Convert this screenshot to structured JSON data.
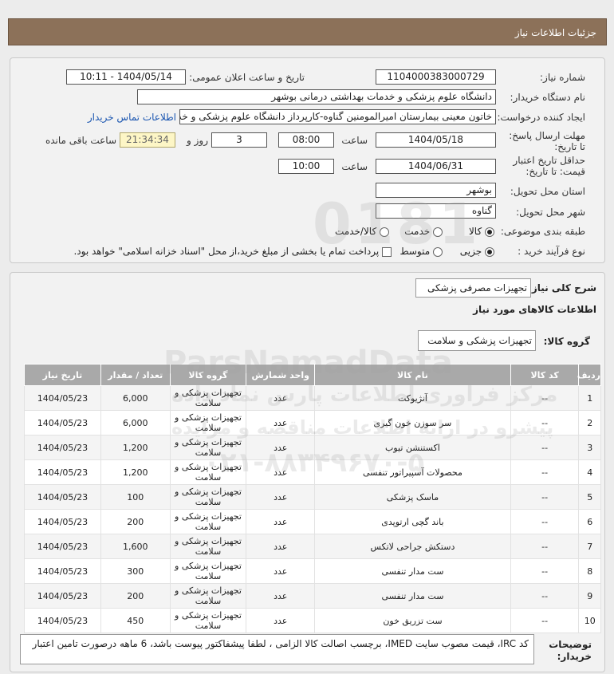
{
  "header": {
    "title": "جزئیات اطلاعات نیاز"
  },
  "info": {
    "need_number_label": "شماره نیاز:",
    "need_number": "1104000383000729",
    "announce_label": "تاریخ و ساعت اعلان عمومی:",
    "announce_value": "1404/05/14 - 10:11",
    "buyer_org_label": "نام دستگاه خریدار:",
    "buyer_org": "دانشگاه علوم پزشکی و خدمات بهداشتی درمانی بوشهر",
    "creator_label": "ایجاد کننده درخواست:",
    "creator": "خاتون معینی بیمارستان امیرالمومنین گناوه-کارپرداز دانشگاه علوم پزشکی و خدم",
    "contact_link": "اطلاعات تماس خریدار",
    "deadline_label": "مهلت ارسال پاسخ: تا تاریخ:",
    "deadline_date": "1404/05/18",
    "time_label": "ساعت",
    "deadline_time": "08:00",
    "days_value": "3",
    "days_label": "روز و",
    "remaining_time": "21:34:34",
    "remaining_label": "ساعت باقی مانده",
    "validity_label": "حداقل تاریخ اعتبار قیمت: تا تاریخ:",
    "validity_date": "1404/06/31",
    "validity_time": "10:00",
    "province_label": "استان محل تحویل:",
    "province": "بوشهر",
    "city_label": "شهر محل تحویل:",
    "city": "گناوه",
    "category_label": "طبقه بندی موضوعی:",
    "category_options": [
      "کالا",
      "خدمت",
      "کالا/خدمت"
    ],
    "category_selected": "کالا",
    "process_label": "نوع فرآیند خرید :",
    "process_options": [
      "جزیی",
      "متوسط"
    ],
    "process_selected": "جزیی",
    "payment_note": "پرداخت تمام یا بخشی از مبلغ خرید،از محل \"اسناد خزانه اسلامی\" خواهد بود."
  },
  "details": {
    "summary_label": "شرح کلی نیاز:",
    "summary": "تجهیزات مصرفی پزشکی",
    "goods_info_title": "اطلاعات کالاهای مورد نیاز",
    "group_label": "گروه کالا:",
    "group": "تجهیزات پزشکی و سلامت",
    "columns": [
      "ردیف",
      "کد کالا",
      "نام کالا",
      "واحد شمارش",
      "گروه کالا",
      "تعداد / مقدار",
      "تاریخ نیاز"
    ],
    "rows": [
      {
        "row": "1",
        "code": "--",
        "name": "آنژیوکت",
        "unit": "عدد",
        "group": "تجهیزات پزشکی و سلامت",
        "qty": "6,000",
        "date": "1404/05/23"
      },
      {
        "row": "2",
        "code": "--",
        "name": "سر سوزن خون گیری",
        "unit": "عدد",
        "group": "تجهیزات پزشکی و سلامت",
        "qty": "6,000",
        "date": "1404/05/23"
      },
      {
        "row": "3",
        "code": "--",
        "name": "اکستنشن تیوب",
        "unit": "عدد",
        "group": "تجهیزات پزشکی و سلامت",
        "qty": "1,200",
        "date": "1404/05/23"
      },
      {
        "row": "4",
        "code": "--",
        "name": "محصولات آسپیراتور تنفسی",
        "unit": "عدد",
        "group": "تجهیزات پزشکی و سلامت",
        "qty": "1,200",
        "date": "1404/05/23"
      },
      {
        "row": "5",
        "code": "--",
        "name": "ماسک پزشکی",
        "unit": "عدد",
        "group": "تجهیزات پزشکی و سلامت",
        "qty": "100",
        "date": "1404/05/23"
      },
      {
        "row": "6",
        "code": "--",
        "name": "باند گچی ارتوپدی",
        "unit": "عدد",
        "group": "تجهیزات پزشکی و سلامت",
        "qty": "200",
        "date": "1404/05/23"
      },
      {
        "row": "7",
        "code": "--",
        "name": "دستکش جراحی لاتکس",
        "unit": "عدد",
        "group": "تجهیزات پزشکی و سلامت",
        "qty": "1,600",
        "date": "1404/05/23"
      },
      {
        "row": "8",
        "code": "--",
        "name": "ست مدار تنفسی",
        "unit": "عدد",
        "group": "تجهیزات پزشکی و سلامت",
        "qty": "300",
        "date": "1404/05/23"
      },
      {
        "row": "9",
        "code": "--",
        "name": "ست مدار تنفسی",
        "unit": "عدد",
        "group": "تجهیزات پزشکی و سلامت",
        "qty": "200",
        "date": "1404/05/23"
      },
      {
        "row": "10",
        "code": "--",
        "name": "ست تزریق خون",
        "unit": "عدد",
        "group": "تجهیزات پزشکی و سلامت",
        "qty": "450",
        "date": "1404/05/23"
      }
    ],
    "buyer_notes_label": "توضیحات خریدار:",
    "buyer_notes": "کد IRC، قیمت مصوب سایت IMED، برچسب اصالت کالا الزامی ، لطفا پیشفاکتور پیوست باشد، 6 ماهه درصورت تامین اعتبار"
  },
  "watermark": {
    "brand": "ParsNamadData",
    "line1": "مرکز فراوری اطلاعات پارس نماد داده",
    "line2": "پیشرو در ارائه اطلاعات مناقصه و مزایده",
    "phone": "۰۲۱-۸۸۳۴۹۶۷۰-۵",
    "number": "0181"
  }
}
